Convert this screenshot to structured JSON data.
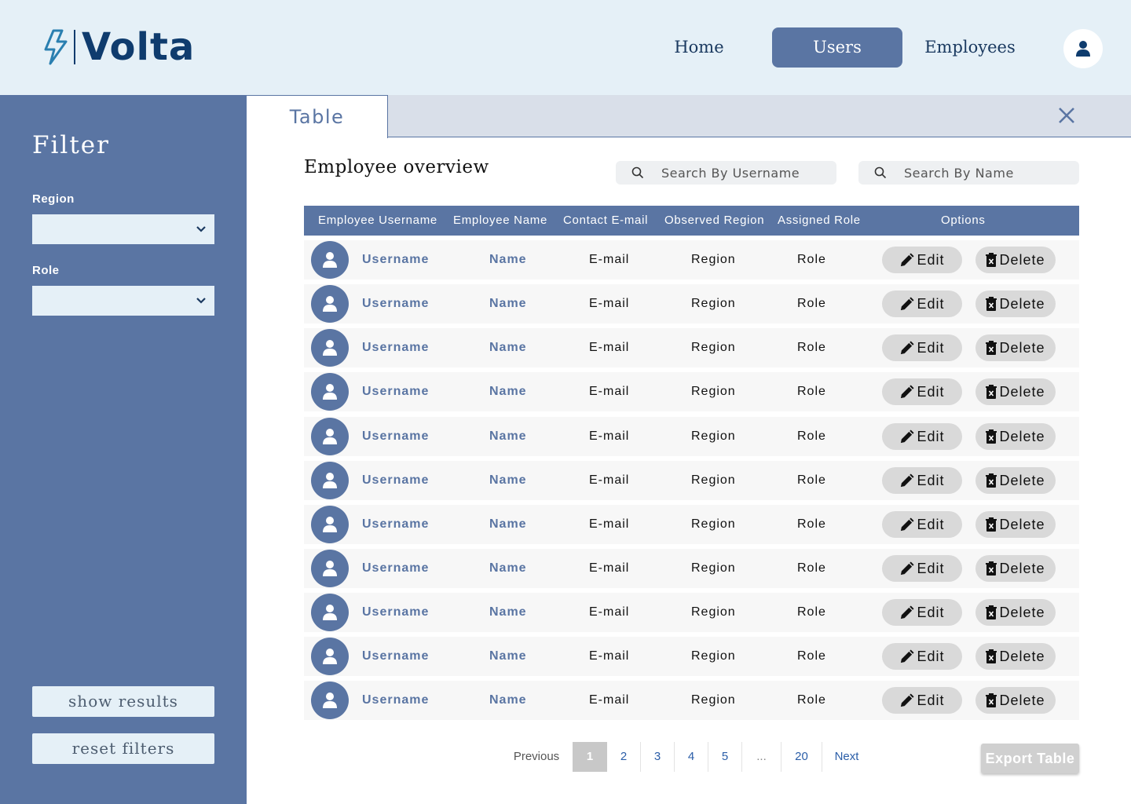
{
  "header": {
    "logo_text": "Volta",
    "nav": [
      {
        "label": "Home",
        "active": false
      },
      {
        "label": "Users",
        "active": true
      },
      {
        "label": "Employees",
        "active": false
      }
    ]
  },
  "sidebar": {
    "title": "Filter",
    "region_label": "Region",
    "region_value": "",
    "role_label": "Role",
    "role_value": "",
    "show_results": "show results",
    "reset_filters": "reset filters"
  },
  "tabs": {
    "active_tab": "Table"
  },
  "main": {
    "title": "Employee overview",
    "search_username_placeholder": "Search By Username",
    "search_name_placeholder": "Search By Name",
    "columns": [
      "Employee Username",
      "Employee Name",
      "Contact E-mail",
      "Observed Region",
      "Assigned Role",
      "Options"
    ],
    "edit_label": "Edit",
    "delete_label": "Delete",
    "rows": [
      {
        "username": "Username",
        "name": "Name",
        "email": "E-mail",
        "region": "Region",
        "role": "Role"
      },
      {
        "username": "Username",
        "name": "Name",
        "email": "E-mail",
        "region": "Region",
        "role": "Role"
      },
      {
        "username": "Username",
        "name": "Name",
        "email": "E-mail",
        "region": "Region",
        "role": "Role"
      },
      {
        "username": "Username",
        "name": "Name",
        "email": "E-mail",
        "region": "Region",
        "role": "Role"
      },
      {
        "username": "Username",
        "name": "Name",
        "email": "E-mail",
        "region": "Region",
        "role": "Role"
      },
      {
        "username": "Username",
        "name": "Name",
        "email": "E-mail",
        "region": "Region",
        "role": "Role"
      },
      {
        "username": "Username",
        "name": "Name",
        "email": "E-mail",
        "region": "Region",
        "role": "Role"
      },
      {
        "username": "Username",
        "name": "Name",
        "email": "E-mail",
        "region": "Region",
        "role": "Role"
      },
      {
        "username": "Username",
        "name": "Name",
        "email": "E-mail",
        "region": "Region",
        "role": "Role"
      },
      {
        "username": "Username",
        "name": "Name",
        "email": "E-mail",
        "region": "Region",
        "role": "Role"
      },
      {
        "username": "Username",
        "name": "Name",
        "email": "E-mail",
        "region": "Region",
        "role": "Role"
      }
    ]
  },
  "pagination": {
    "previous": "Previous",
    "pages": [
      "1",
      "2",
      "3",
      "4",
      "5"
    ],
    "ellipsis": "...",
    "last": "20",
    "next": "Next",
    "current": "1"
  },
  "export_label": "Export Table",
  "colors": {
    "brand": "#5a75a3",
    "header_bg": "#e5f0f7",
    "logo": "#0f3c6e"
  }
}
